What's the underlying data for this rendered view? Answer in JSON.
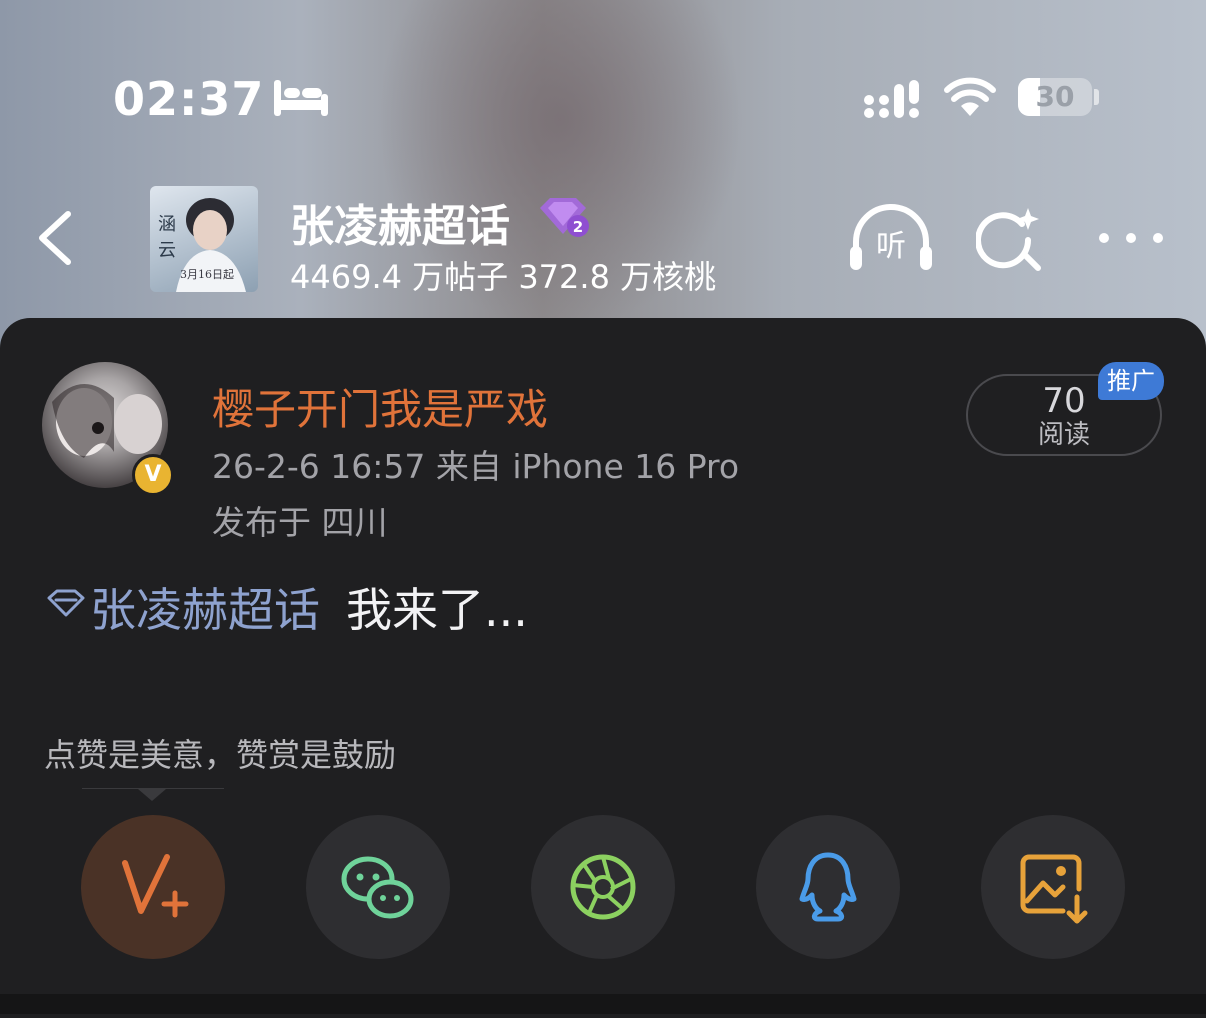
{
  "status_bar": {
    "time": "02:37",
    "battery": "30",
    "battery_level": 0.3
  },
  "header": {
    "topic_title": "张凌赫超话",
    "topic_level": "2",
    "stats": "4469.4 万帖子 372.8 万核桃",
    "listen_label": "听",
    "cover_text": "3月16日起"
  },
  "post": {
    "username": "樱子开门我是严戏",
    "verified_mark": "V",
    "meta": "26-2-6 16:57  来自 iPhone 16 Pro",
    "location": "发布于 四川",
    "reads_count": "70",
    "reads_label": "阅读",
    "promo_tag": "推广",
    "topic_link": "张凌赫超话",
    "text": "我来了..."
  },
  "tip": {
    "text": "点赞是美意，赞赏是鼓励"
  },
  "share": {
    "buttons": [
      {
        "icon": "v-plus-icon",
        "color": "#e0733a"
      },
      {
        "icon": "wechat-icon",
        "color": "#6fd39a"
      },
      {
        "icon": "moments-icon",
        "color": "#8cd160"
      },
      {
        "icon": "qq-icon",
        "color": "#4a9be8"
      },
      {
        "icon": "save-image-icon",
        "color": "#e7a23a"
      }
    ]
  }
}
